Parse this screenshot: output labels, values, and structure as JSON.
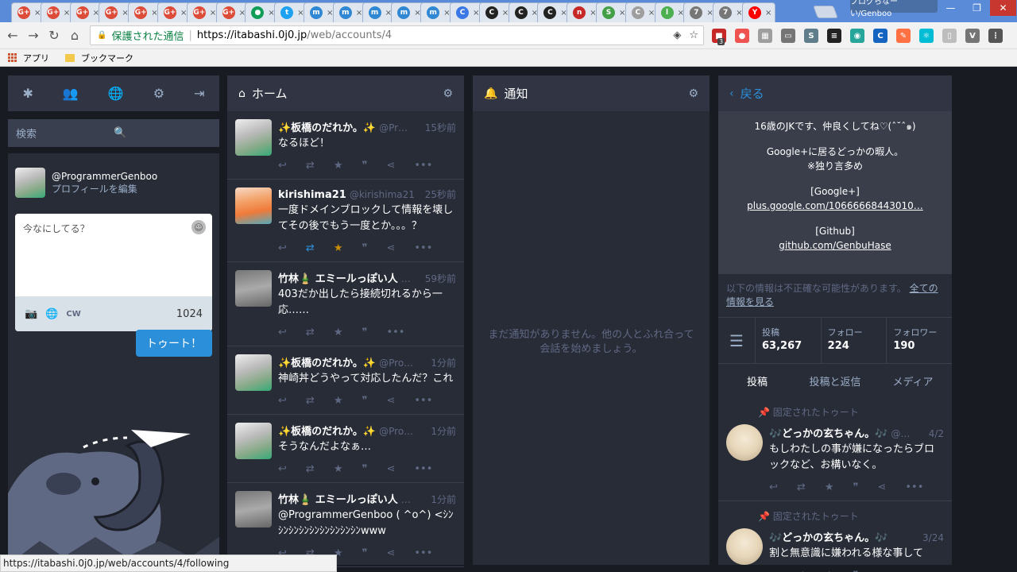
{
  "browser": {
    "tabs": [
      {
        "icon": "google-plus-icon",
        "label": "G+",
        "color": "#dd4b39"
      },
      {
        "icon": "google-plus-icon",
        "label": "G+",
        "color": "#dd4b39"
      },
      {
        "icon": "google-plus-icon",
        "label": "G+",
        "color": "#dd4b39"
      },
      {
        "icon": "google-plus-icon",
        "label": "G+",
        "color": "#dd4b39"
      },
      {
        "icon": "google-plus-icon",
        "label": "G+",
        "color": "#dd4b39"
      },
      {
        "icon": "google-plus-icon",
        "label": "G+",
        "color": "#dd4b39"
      },
      {
        "icon": "google-plus-icon",
        "label": "G+",
        "color": "#dd4b39"
      },
      {
        "icon": "google-plus-icon",
        "label": "G+",
        "color": "#dd4b39"
      },
      {
        "icon": "hangouts-icon",
        "label": "●",
        "color": "#0f9d58"
      },
      {
        "icon": "twitter-icon",
        "label": "t",
        "color": "#1da1f2"
      },
      {
        "icon": "mastodon-icon",
        "label": "m",
        "color": "#3088d4"
      },
      {
        "icon": "mastodon-icon",
        "label": "m",
        "color": "#3088d4"
      },
      {
        "icon": "mastodon-icon",
        "label": "m",
        "color": "#3088d4"
      },
      {
        "icon": "mastodon-icon",
        "label": "m",
        "color": "#3088d4"
      },
      {
        "icon": "mastodon-icon",
        "label": "m",
        "color": "#3088d4"
      },
      {
        "icon": "refresh-icon",
        "label": "C",
        "color": "#3b78e7"
      },
      {
        "icon": "github-icon",
        "label": "C",
        "color": "#222222"
      },
      {
        "icon": "github-icon",
        "label": "C",
        "color": "#222222"
      },
      {
        "icon": "github-icon",
        "label": "C",
        "color": "#222222"
      },
      {
        "icon": "red-box-icon",
        "label": "n",
        "color": "#c62828"
      },
      {
        "icon": "leaf-icon",
        "label": "S",
        "color": "#43a047"
      },
      {
        "icon": "document-icon",
        "label": "C",
        "color": "#9e9e9e"
      },
      {
        "icon": "green-icon",
        "label": "l",
        "color": "#4caf50"
      },
      {
        "icon": "image-icon",
        "label": "7",
        "color": "#777777"
      },
      {
        "icon": "image-icon",
        "label": "7",
        "color": "#777777"
      },
      {
        "icon": "youtube-icon",
        "label": "Y",
        "color": "#ff0000"
      }
    ],
    "profile_label": "ブログらなーい/Genboo",
    "window_controls": [
      "—",
      "❐",
      "✕"
    ],
    "secure_label": "保護された通信",
    "url_host": "https://itabashi.0j0.jp",
    "url_path": "/web/accounts/4",
    "ext_badge": "3",
    "extensions": [
      {
        "icon": "ext-red-icon",
        "label": "■",
        "color": "#c62828"
      },
      {
        "icon": "ext-circle-icon",
        "label": "●",
        "color": "#ef5350"
      },
      {
        "icon": "ext-puzzle-icon",
        "label": "▦",
        "color": "#9e9e9e"
      },
      {
        "icon": "cast-icon",
        "label": "▭",
        "color": "#757575"
      },
      {
        "icon": "ext-s-icon",
        "label": "S",
        "color": "#607d8b"
      },
      {
        "icon": "buffer-icon",
        "label": "≡",
        "color": "#222222"
      },
      {
        "icon": "ext-green-icon",
        "label": "◉",
        "color": "#26a69a"
      },
      {
        "icon": "ext-c-icon",
        "label": "C",
        "color": "#1565c0"
      },
      {
        "icon": "ext-orange-icon",
        "label": "✎",
        "color": "#ff7043"
      },
      {
        "icon": "react-icon",
        "label": "⚛",
        "color": "#00bcd4"
      },
      {
        "icon": "ext-doc-icon",
        "label": "▯",
        "color": "#bdbdbd"
      },
      {
        "icon": "ext-v-icon",
        "label": "V",
        "color": "#757575"
      },
      {
        "icon": "menu-icon",
        "label": "⋮",
        "color": "#555555"
      }
    ],
    "bookmarks": {
      "apps": "アプリ",
      "bookmarks": "ブックマーク"
    },
    "status_url": "https://itabashi.0j0.jp/web/accounts/4/following"
  },
  "compose": {
    "search_placeholder": "検索",
    "username": "@ProgrammerGenboo",
    "edit_profile": "プロフィールを編集",
    "placeholder": "今なにしてる？",
    "cw_label": "CW",
    "char_count": "1024",
    "toot_button": "トゥート！"
  },
  "home": {
    "title": "ホーム",
    "statuses": [
      {
        "name": "✨板橋のだれか。✨",
        "acct": "@Pr…",
        "time": "15秒前",
        "text": "なるほど！",
        "avatar": "default",
        "fav": false,
        "boost": false
      },
      {
        "name": "kirishima21",
        "acct": "@kirishima21",
        "time": "25秒前",
        "text": "一度ドメインブロックして情報を壊してその後でもう一度とか。。。？",
        "avatar": "girl",
        "fav": true,
        "boost": true
      },
      {
        "name": "竹林🎍 エミールっぽい人",
        "acct": "…",
        "time": "59秒前",
        "text": "403だか出したら接続切れるから一応……",
        "avatar": "gray",
        "fav": false,
        "boost": false
      },
      {
        "name": "✨板橋のだれか。✨",
        "acct": "@Pro…",
        "time": "1分前",
        "text": "神崎丼どうやって対応したんだ？これ",
        "avatar": "default",
        "fav": false,
        "boost": false
      },
      {
        "name": "✨板橋のだれか。✨",
        "acct": "@Pro…",
        "time": "1分前",
        "text": "そうなんだよなぁ…",
        "avatar": "default",
        "fav": false,
        "boost": false
      },
      {
        "name": "竹林🎍 エミールっぽい人",
        "acct": "…",
        "time": "1分前",
        "text": "@ProgrammerGenboo ( ^o^) <ｼﾝｼﾝｼﾝｼﾝｼﾝｼﾝｼﾝｼﾝｼﾝwww",
        "avatar": "gray",
        "fav": false,
        "boost": false
      }
    ]
  },
  "notifications": {
    "title": "通知",
    "empty": "まだ通知がありません。他の人とふれ合って会話を始めましょう。"
  },
  "profile": {
    "back": "戻る",
    "bio_lines": [
      "16歳のJKです、仲良くしてね♡(ˆ˘ˆ๑)",
      "",
      "Google+に居るどっかの暇人。",
      "※独り言多め",
      "",
      "[Google+]"
    ],
    "bio_link1": "plus.google.com/10666668443010…",
    "bio_github_label": "[Github]",
    "bio_link2": "github.com/GenbuHase",
    "warning": "以下の情報は不正確な可能性があります。",
    "warning_link": "全ての情報を見る",
    "counts": [
      {
        "label": "投稿",
        "value": "63,267"
      },
      {
        "label": "フォロー",
        "value": "224"
      },
      {
        "label": "フォロワー",
        "value": "190"
      }
    ],
    "tabs": [
      "投稿",
      "投稿と返信",
      "メディア"
    ],
    "pinned_label": "固定されたトゥート",
    "statuses": [
      {
        "name": "🎶どっかの玄ちゃん。🎶",
        "acct": "@…",
        "time": "4/2",
        "text": "もしわたしの事が嫌になったらブロックなど、お構いなく。"
      },
      {
        "name": "🎶どっかの玄ちゃん。🎶",
        "acct": "",
        "time": "3/24",
        "text": "割と無意識に嫌われる様な事して"
      }
    ]
  }
}
